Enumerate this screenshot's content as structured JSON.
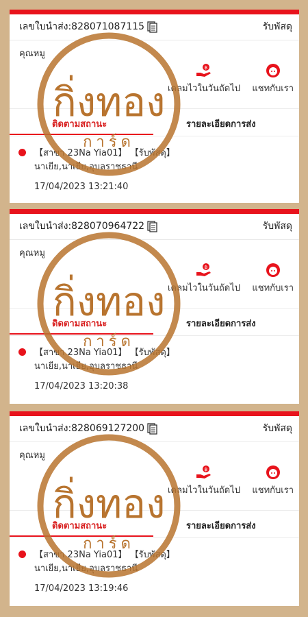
{
  "cards": [
    {
      "waybill": "เลขใบนำส่ง:828071087115",
      "status": "รับพัสดุ",
      "customer": "คุณหมู",
      "reclaim_label": "เคลมไวในวันถัดไป",
      "chat_label": "แชทกับเรา",
      "tab_track": "ติดตามสถานะ",
      "tab_detail": "รายละเอียดการส่ง",
      "branch": "【สาขา 23Na Yia01】 【รับพัสดุ】",
      "address": "นาเยีย,นาเยีย,อุบลราชธานี",
      "time": "17/04/2023 13:21:40"
    },
    {
      "waybill": "เลขใบนำส่ง:828070964722",
      "status": "รับพัสดุ",
      "customer": "คุณหมู",
      "reclaim_label": "เคลมไวในวันถัดไป",
      "chat_label": "แชทกับเรา",
      "tab_track": "ติดตามสถานะ",
      "tab_detail": "รายละเอียดการส่ง",
      "branch": "【สาขา 23Na Yia01】 【รับพัสดุ】",
      "address": "นาเยีย,นาเยีย,อุบลราชธานี",
      "time": "17/04/2023 13:20:38"
    },
    {
      "waybill": "เลขใบนำส่ง:828069127200",
      "status": "รับพัสดุ",
      "customer": "คุณหมู",
      "reclaim_label": "เคลมไวในวันถัดไป",
      "chat_label": "แชทกับเรา",
      "tab_track": "ติดตามสถานะ",
      "tab_detail": "รายละเอียดการส่ง",
      "branch": "【สาขา 23Na Yia01】 【รับพัสดุ】",
      "address": "นาเยีย,นาเยีย,อุบลราชธานี",
      "time": "17/04/2023 13:19:46"
    }
  ],
  "watermark": {
    "line1": "กิ่งทอง",
    "line2": "การ์ด"
  },
  "colors": {
    "accent": "#e8131c",
    "background": "#d2b48c",
    "watermark": "#b8742f"
  },
  "icons": {
    "copy": "copy-icon",
    "reclaim": "hand-coin-icon",
    "chat": "agent-headset-icon"
  }
}
